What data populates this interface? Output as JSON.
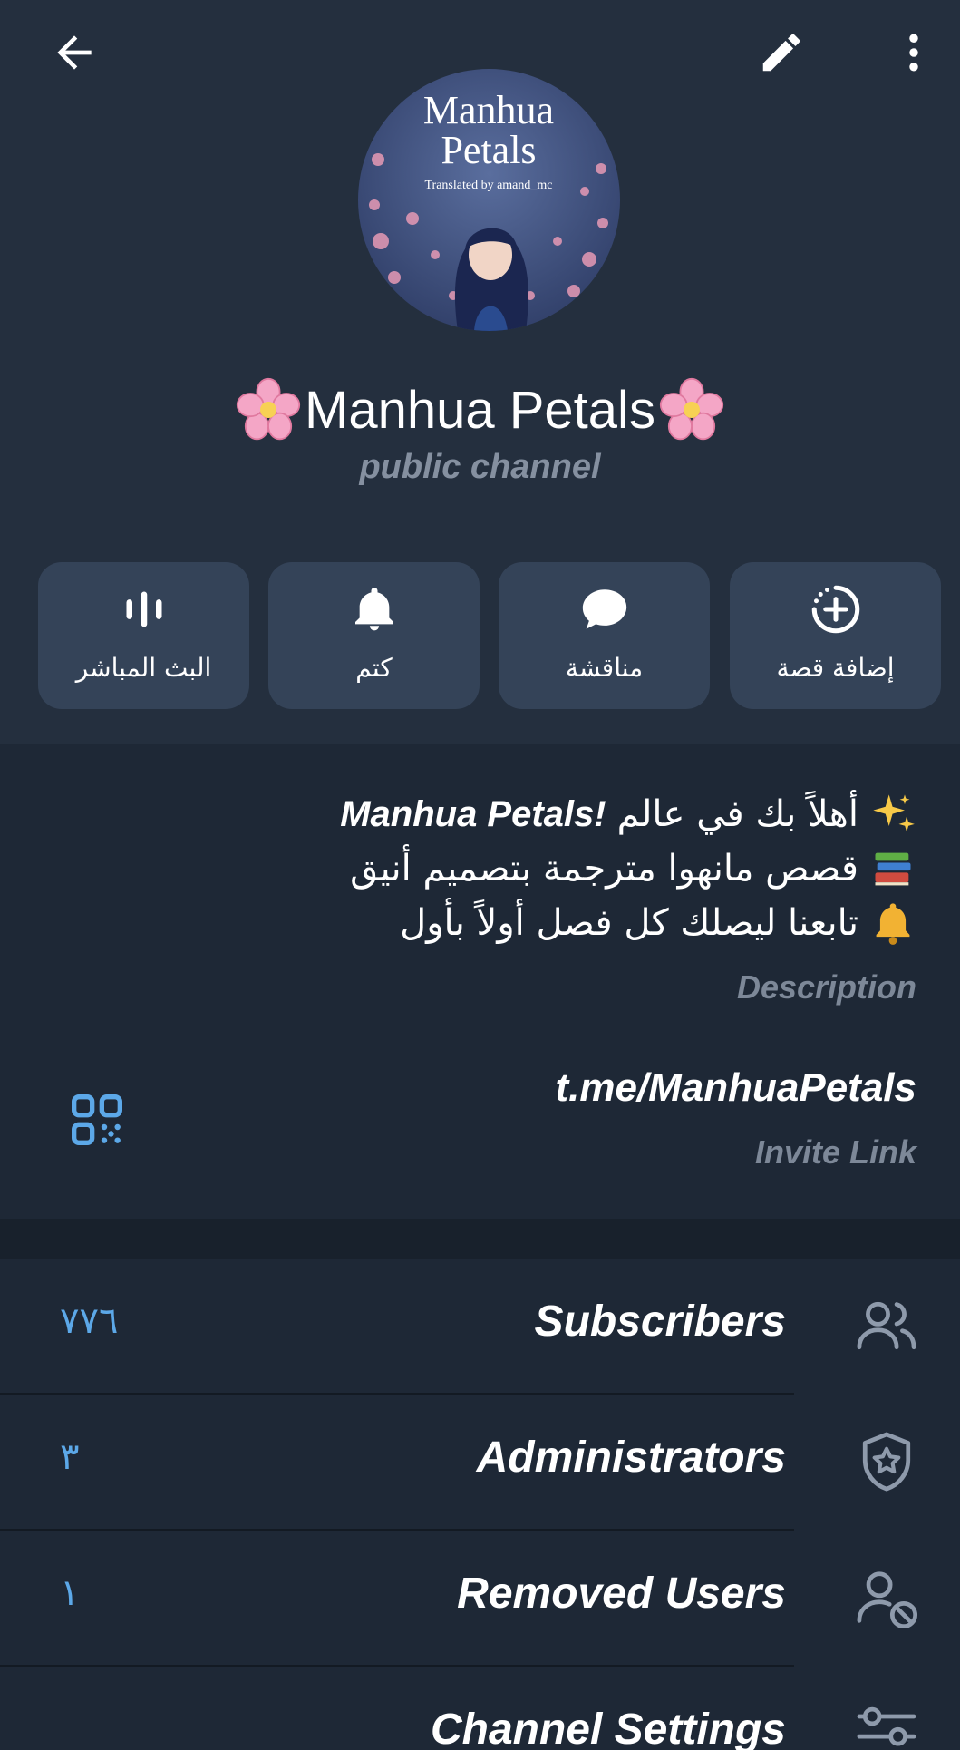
{
  "header": {
    "channel_name": "Manhua Petals",
    "channel_type": "public channel",
    "avatar": {
      "title_line1": "Manhua",
      "title_line2": "Petals",
      "credit": "Translated by amand_mc"
    },
    "icons": [
      "back-arrow-icon",
      "edit-pencil-icon",
      "more-vertical-icon"
    ]
  },
  "actions": [
    {
      "label": "البث المباشر",
      "icon": "live-stream-icon"
    },
    {
      "label": "كتم",
      "icon": "bell-icon"
    },
    {
      "label": "مناقشة",
      "icon": "chat-bubble-icon"
    },
    {
      "label": "إضافة قصة",
      "icon": "add-story-icon"
    }
  ],
  "description": {
    "line1_text": "أهلاً بك في عالم",
    "line1_bold": "Manhua Petals!",
    "line2_text": "قصص مانهوا مترجمة بتصميم أنيق",
    "line3_text": "تابعنا ليصلك كل فصل أولاً بأول",
    "caption": "Description"
  },
  "invite": {
    "link": "t.me/ManhuaPetals",
    "caption": "Invite Link"
  },
  "rows": [
    {
      "label": "Subscribers",
      "count": "٧٧٦",
      "icon": "users-icon"
    },
    {
      "label": "Administrators",
      "count": "٣",
      "icon": "admin-shield-icon"
    },
    {
      "label": "Removed Users",
      "count": "١",
      "icon": "removed-user-icon"
    },
    {
      "label": "Channel Settings",
      "count": "",
      "icon": "settings-sliders-icon"
    }
  ],
  "colors": {
    "header_bg": "#242f3e",
    "body_bg": "#1e2836",
    "button_bg": "#344358",
    "accent": "#5ca8e8",
    "muted_text": "#7d8898"
  }
}
